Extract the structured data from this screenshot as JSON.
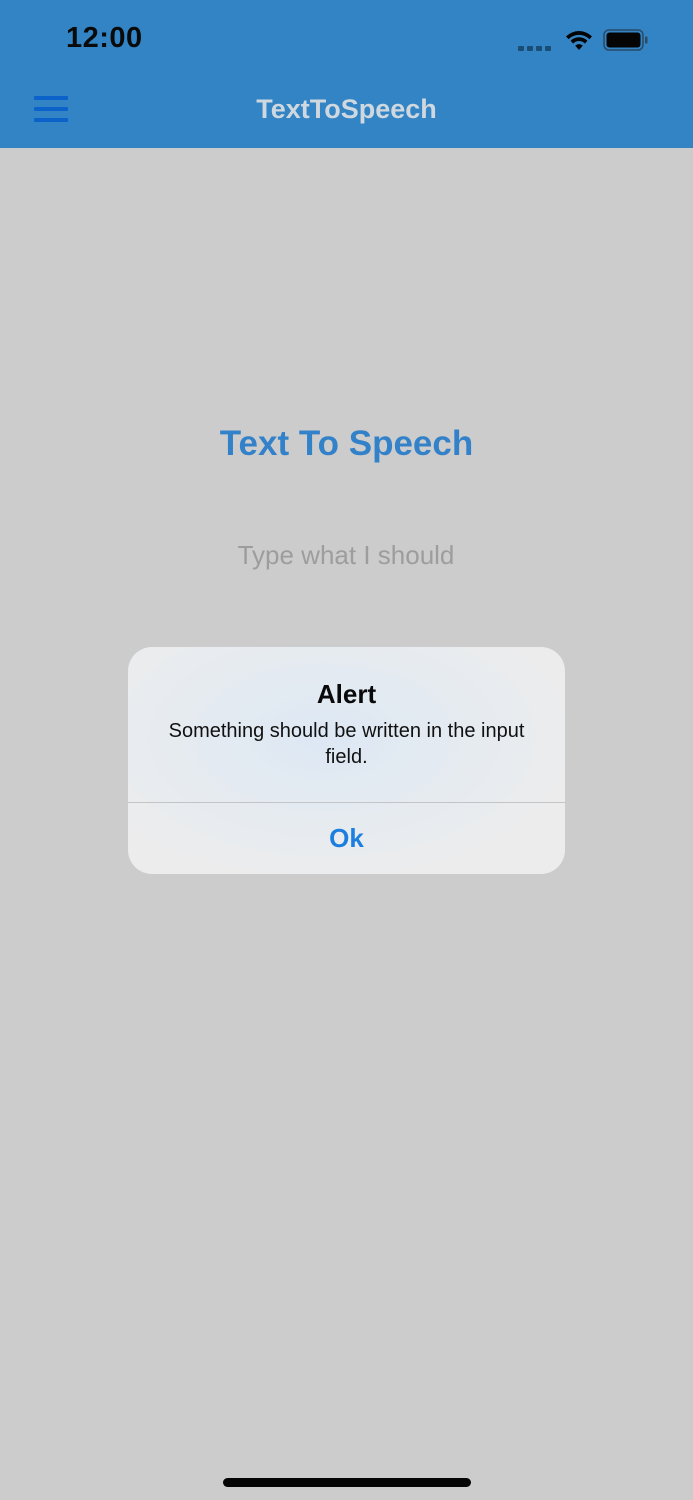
{
  "status_bar": {
    "time": "12:00",
    "icons": [
      "cellular-signal-icon",
      "wifi-icon",
      "battery-icon"
    ]
  },
  "nav": {
    "title": "TextToSpeech",
    "menu_icon": "hamburger-menu-icon"
  },
  "main": {
    "heading": "Text To Speech",
    "input": {
      "value": "",
      "placeholder": "Type what I should"
    }
  },
  "alert": {
    "title": "Alert",
    "message": "Something should be written in the input field.",
    "ok_label": "Ok"
  },
  "colors": {
    "nav_bar": "#3384c4",
    "menu_icon": "#0b63c9",
    "heading": "#3382c9",
    "alert_button": "#1c7fe0",
    "background": "#cccccc"
  }
}
